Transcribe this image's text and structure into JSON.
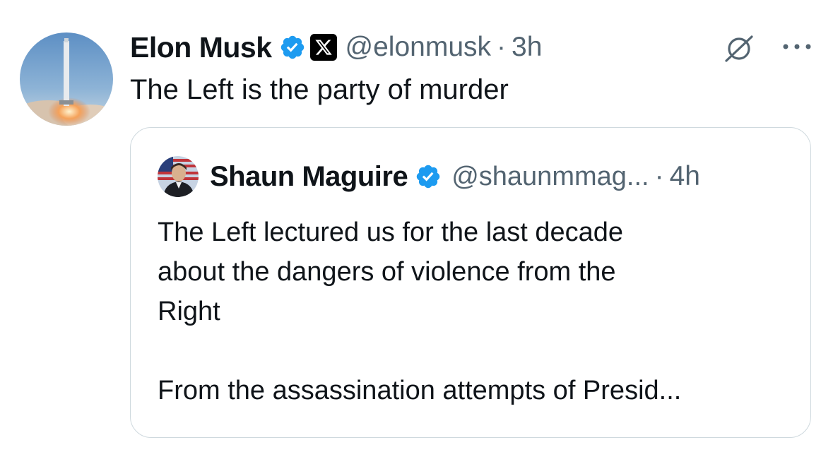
{
  "tweet": {
    "author_name": "Elon Musk",
    "handle": "@elonmusk",
    "separator": "·",
    "time": "3h",
    "text": "The Left is the party of murder"
  },
  "quoted_tweet": {
    "author_name": "Shaun Maguire",
    "handle": "@shaunmmag...",
    "separator": "·",
    "time": "4h",
    "text": "The Left lectured us for the last decade\nabout the dangers of violence from the\nRight\n\nFrom the assassination attempts of Presid..."
  },
  "icons": {
    "verified": "verified-badge-icon",
    "affiliation": "x-logo-icon",
    "grok": "grok-icon",
    "more": "more-options-icon"
  },
  "colors": {
    "verified_blue": "#1d9bf0",
    "text_primary": "#0f1419",
    "text_secondary": "#536471",
    "border": "#cfd9de"
  }
}
